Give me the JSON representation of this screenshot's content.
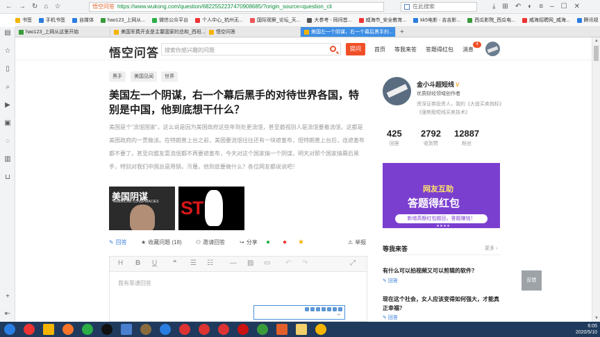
{
  "browser": {
    "nav_icons": [
      "back-icon",
      "forward-icon",
      "reload-icon",
      "home-icon"
    ],
    "site_label": "悟空问答",
    "url": "https://www.wukong.com/question/6822552237470908685/?origin_source=question_cli",
    "search_placeholder": "在此搜索",
    "bookmarks": [
      {
        "label": "书签",
        "color": "#f5b400"
      },
      {
        "label": "手机书签",
        "color": "#2a7de1"
      },
      {
        "label": "自媒体",
        "color": "#2a7de1"
      },
      {
        "label": "hao123_上网从...",
        "color": "#3a9b3a"
      },
      {
        "label": "微信公众平台",
        "color": "#2bae46"
      },
      {
        "label": "个人中心_杭州无...",
        "color": "#e33"
      },
      {
        "label": "国际观察_论坛_天...",
        "color": "#e55"
      },
      {
        "label": "大参考 - 同间首...",
        "color": "#555"
      },
      {
        "label": "威海市_安全教育...",
        "color": "#e33"
      },
      {
        "label": "kk5电影 - 吉吉影...",
        "color": "#2a7de1"
      },
      {
        "label": "西瓜影院_西瓜电...",
        "color": "#3a9b3a"
      },
      {
        "label": "威海招聘网_威海...",
        "color": "#e33"
      },
      {
        "label": "腾讯视",
        "color": "#2a7de1"
      }
    ],
    "tabs": [
      {
        "label": "hao123_上网从这里开始",
        "color": "#3a9b3a",
        "active": false
      },
      {
        "label": "美国军费开支是主要国家的总和_西班...",
        "color": "#f5b400",
        "active": false
      },
      {
        "label": "悟空问答",
        "color": "#f5b400",
        "active": false
      },
      {
        "label": "美国左一个阴谋，右一个幕后黑手的...",
        "color": "#f5b400",
        "active": true
      }
    ]
  },
  "header": {
    "logo": "悟空问答",
    "search_placeholder": "搜索你感兴趣的问题",
    "ask_button": "提问",
    "nav": [
      "首页",
      "等我来答",
      "答题得红包",
      "消息"
    ],
    "message_badge": "4"
  },
  "question": {
    "tags": [
      "黑手",
      "美国见闻",
      "世界"
    ],
    "title": "美国左一个阴谋，右一个幕后黑手的对待世界各国，特别是中国，他到底想干什么？",
    "description": "美国是个\"流氓国家\"，这么说是因为美国政府这些年到处更流氓，甚至藐视别人是流氓要着流氓，这都是美国政府的一贯做派。在特朗普上台之前，美国要流氓往往还有一块遮羞布，但特朗普上台后，连遮羞布都不要了，甚至向盟友耍流氓都不再要遮羞布，今天对这个国家搞一个阴谋，明天对那个国家搞幕后黑手，特别对我们中国总是用锅，污蔑，他到底要做什么？各位网友都说说吧！",
    "image1_text": "美国阴谋",
    "image1_sub": "AMERICAN CONSPIRACIES",
    "image2_text": "ST P"
  },
  "actions": {
    "answer": "回答",
    "favorite": "收藏问题 (18)",
    "invite": "邀请回答",
    "share": "分享",
    "report": "举报"
  },
  "editor": {
    "placeholder": "我有靠谱回答"
  },
  "author": {
    "name": "金小斗超短线",
    "role": "优质财经领域创作者",
    "bio": "资深证券投资人，我的《大盘买卖指标》《强势股短线买卖技术》",
    "stats": [
      {
        "value": "425",
        "label": "回答"
      },
      {
        "value": "2792",
        "label": "收到赞"
      },
      {
        "value": "12887",
        "label": "粉丝"
      }
    ]
  },
  "banner": {
    "line1": "网友互助",
    "line2": "答题得红包",
    "line3": "新增高额红包题目，答题赚钱！"
  },
  "waiting": {
    "title": "等我来答",
    "more": "更多",
    "items": [
      {
        "question": "有什么可以拍视频又可以剪辑的软件？",
        "answer": "回答"
      },
      {
        "question": "现在这个社会，女人应该变得如何强大，才能真正幸福？",
        "answer": "回答"
      }
    ]
  },
  "feedback": "反馈",
  "taskbar": {
    "time": "6:05",
    "date": "2020/5/10"
  }
}
